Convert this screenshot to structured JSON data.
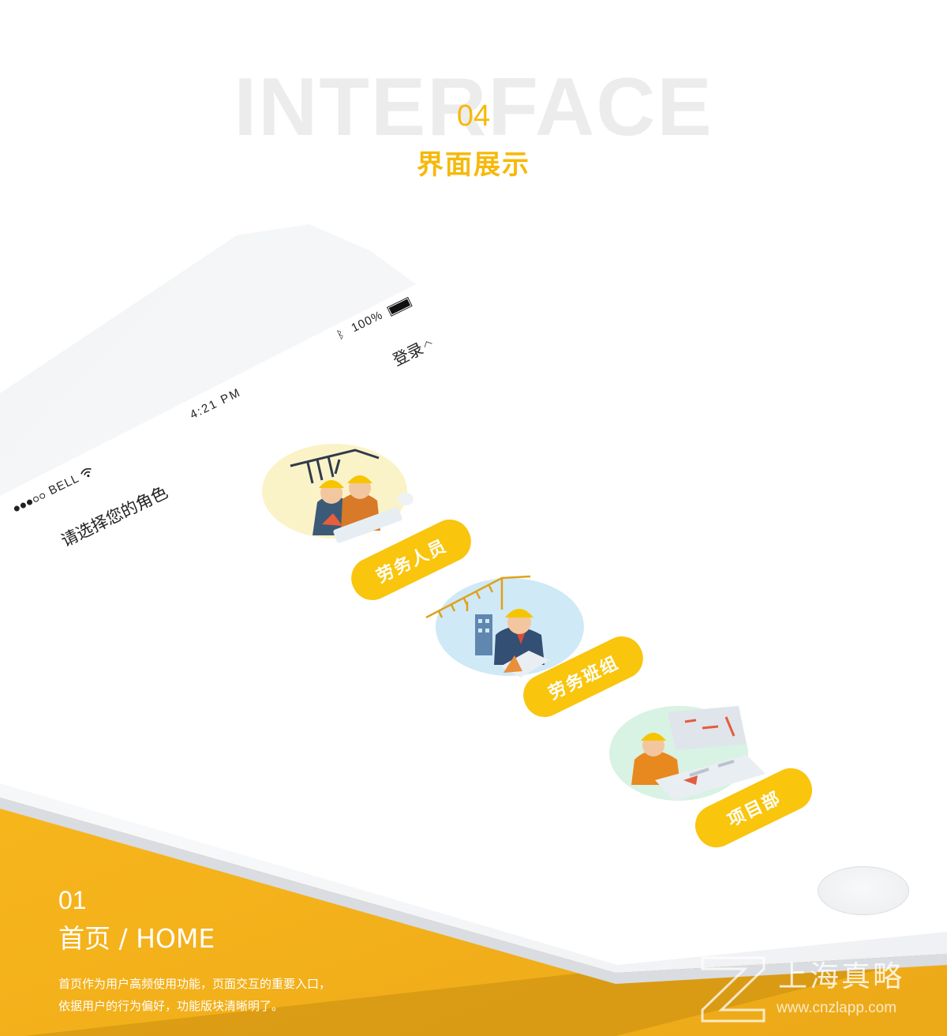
{
  "header": {
    "background_word": "INTERFACE",
    "section_number": "04",
    "section_title": "界面展示"
  },
  "phone": {
    "status_bar": {
      "carrier": "BELL",
      "time": "4:21 PM",
      "battery_text": "100%",
      "signal_dots_filled": 3,
      "signal_dots_empty": 2
    },
    "login_label": "登录",
    "prompt": "请选择您的角色",
    "roles": [
      {
        "label": "劳务人员",
        "icon": "construction-workers-illustration"
      },
      {
        "label": "劳务班组",
        "icon": "crane-supervisor-illustration"
      },
      {
        "label": "项目部",
        "icon": "project-manager-illustration"
      }
    ]
  },
  "caption": {
    "number": "01",
    "title": "首页 / HOME",
    "description_lines": [
      "首页作为用户高频使用功能，页面交互的重要入口，",
      "依据用户的行为偏好，功能版块清晰明了。"
    ]
  },
  "watermark": {
    "brand": "上海真略",
    "url": "www.cnzlapp.com"
  },
  "colors": {
    "accent_yellow": "#f9c50d",
    "band_yellow": "#ffc622",
    "background_word": "#ececec"
  }
}
